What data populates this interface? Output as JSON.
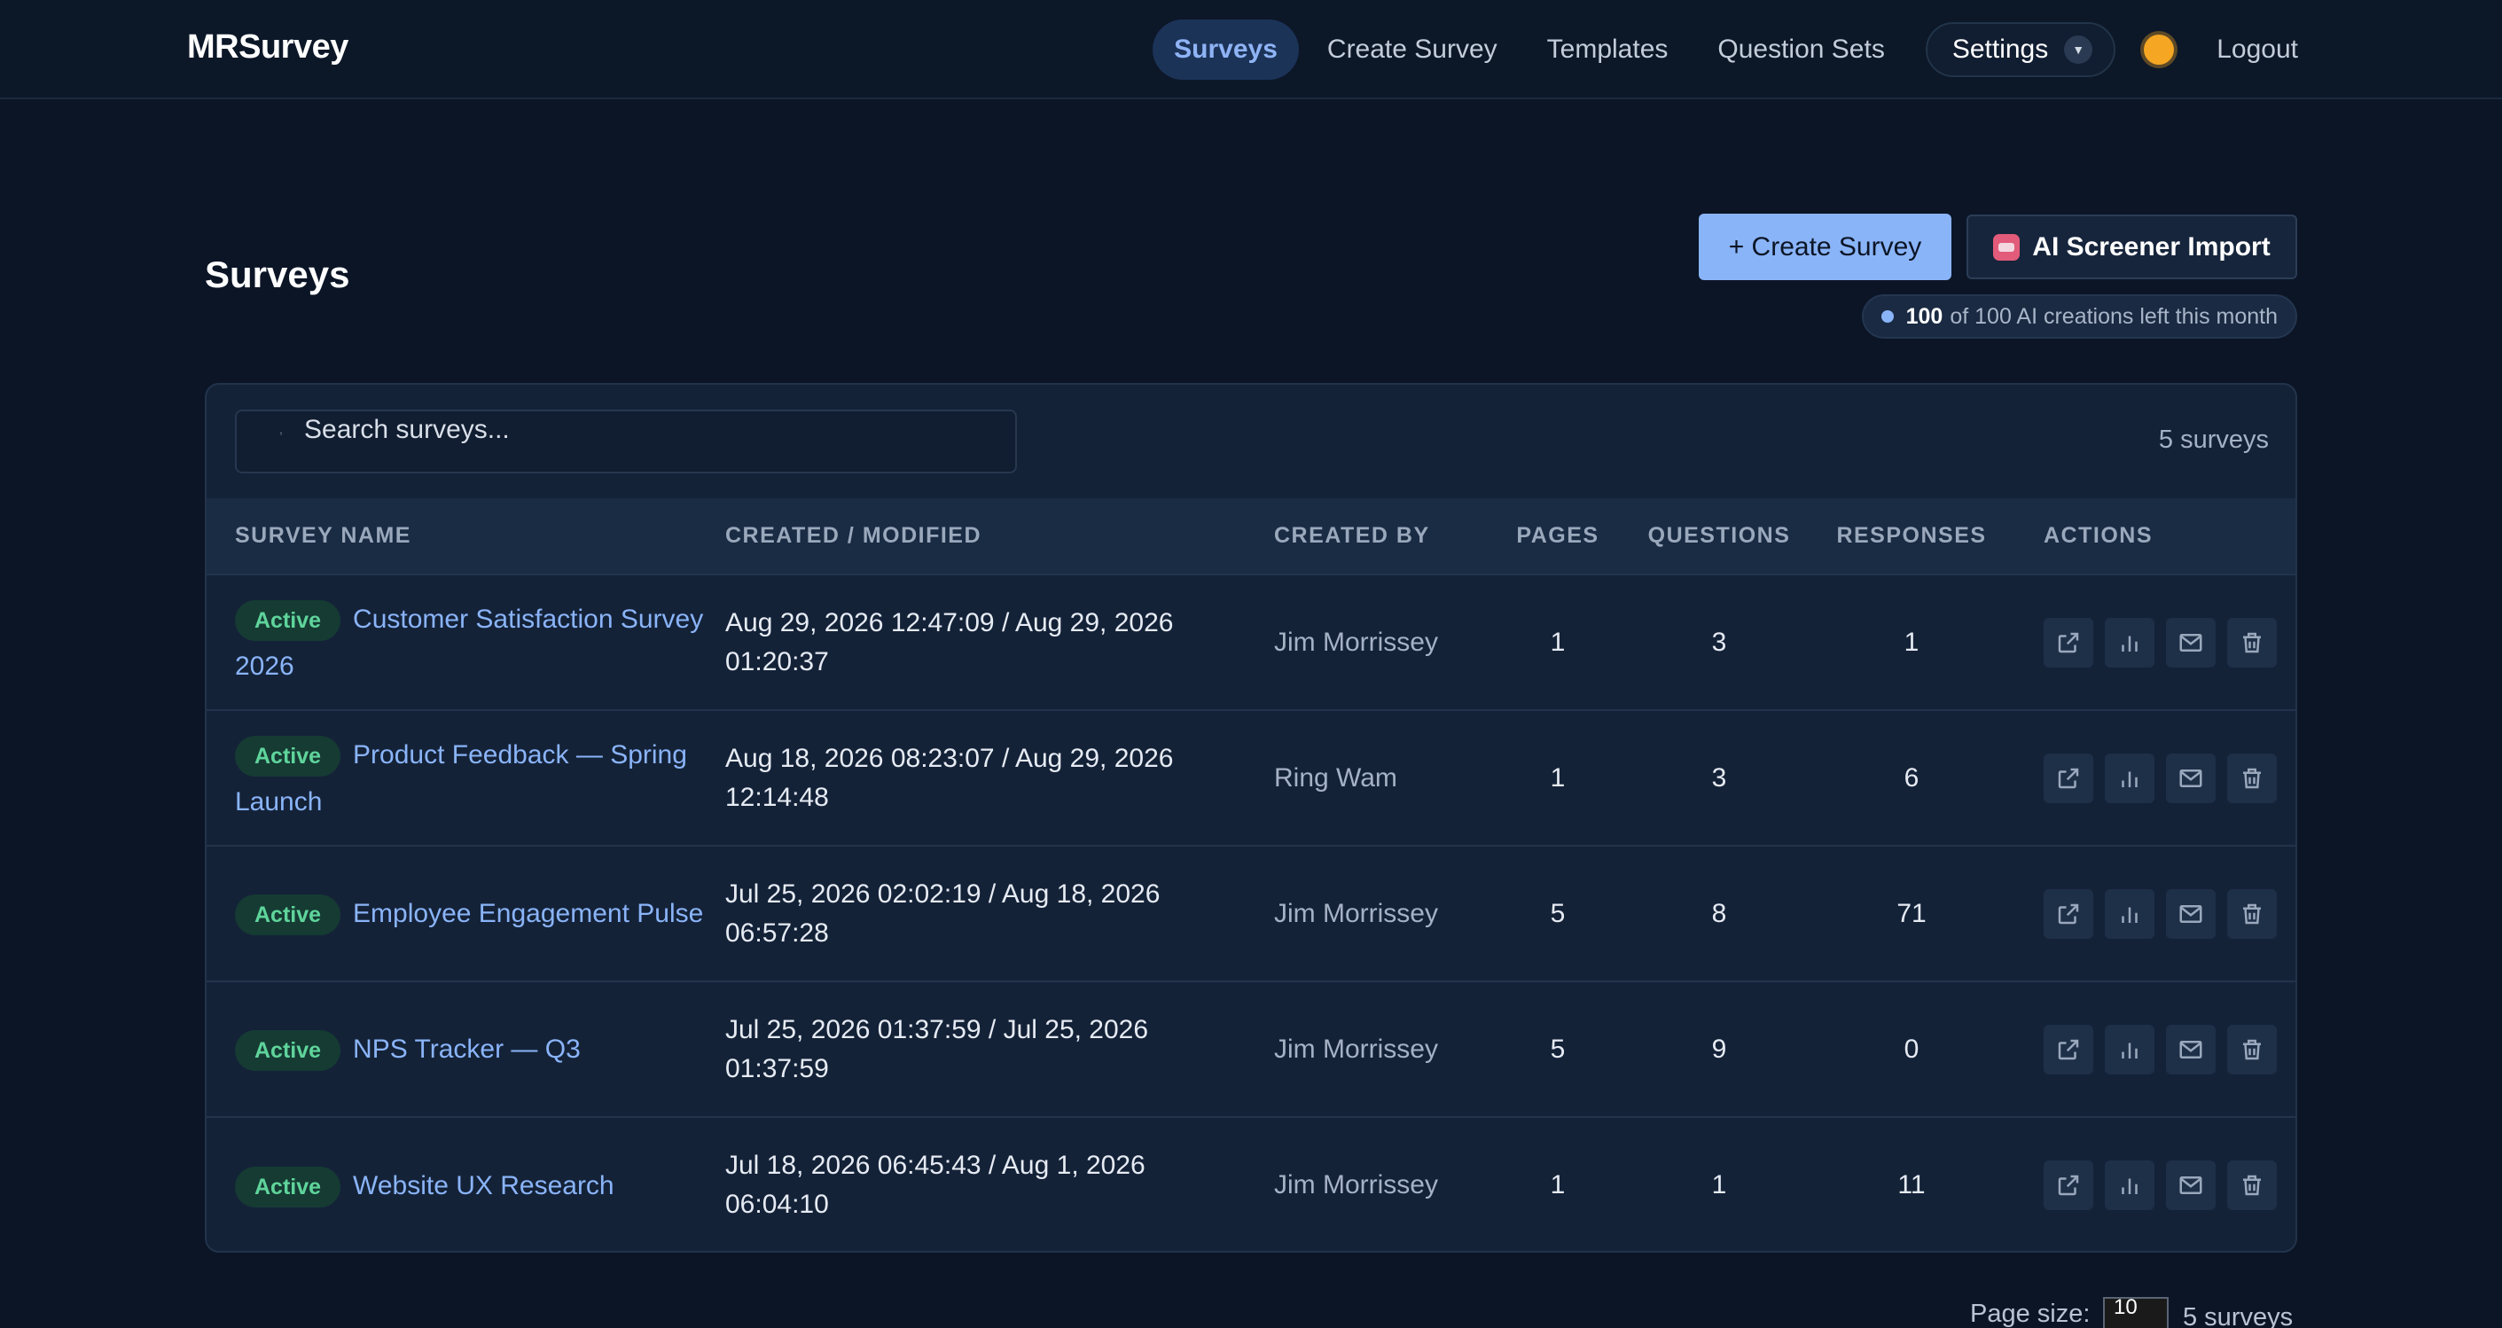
{
  "nav": {
    "brand": "MRSurvey",
    "links": [
      "Surveys",
      "Create Survey",
      "Templates",
      "Question Sets"
    ],
    "active": "Surveys",
    "settings_label": "Settings",
    "logout_label": "Logout",
    "theme_icon": "sun-icon"
  },
  "header": {
    "title": "Surveys",
    "create_label": "+ Create Survey",
    "ai_label": "AI Screener Import",
    "quota_count": "100",
    "quota_text": "of 100 AI creations left this month"
  },
  "search": {
    "placeholder": "Search surveys...",
    "count": "5 surveys"
  },
  "table": {
    "columns": [
      "SURVEY NAME",
      "CREATED / MODIFIED",
      "CREATED BY",
      "PAGES",
      "QUESTIONS",
      "RESPONSES",
      "ACTIONS"
    ],
    "rows": [
      {
        "status": "Active",
        "name": "Customer Satisfaction Survey 2026",
        "dates": "Aug 29, 2026 12:47:09 / Aug 29, 2026 01:20:37",
        "by": "Jim Morrissey",
        "pages": "1",
        "questions": "3",
        "responses": "1"
      },
      {
        "status": "Active",
        "name": "Product Feedback — Spring Launch",
        "dates": "Aug 18, 2026 08:23:07 / Aug 29, 2026 12:14:48",
        "by": "Ring Wam",
        "pages": "1",
        "questions": "3",
        "responses": "6"
      },
      {
        "status": "Active",
        "name": "Employee Engagement Pulse",
        "dates": "Jul 25, 2026 02:02:19 / Aug 18, 2026 06:57:28",
        "by": "Jim Morrissey",
        "pages": "5",
        "questions": "8",
        "responses": "71"
      },
      {
        "status": "Active",
        "name": "NPS Tracker — Q3",
        "dates": "Jul 25, 2026 01:37:59 / Jul 25, 2026 01:37:59",
        "by": "Jim Morrissey",
        "pages": "5",
        "questions": "9",
        "responses": "0"
      },
      {
        "status": "Active",
        "name": "Website UX Research",
        "dates": "Jul 18, 2026 06:45:43 / Aug 1, 2026 06:04:10",
        "by": "Jim Morrissey",
        "pages": "1",
        "questions": "1",
        "responses": "11"
      }
    ],
    "action_icons": [
      "external-link-icon",
      "bar-chart-icon",
      "mail-icon",
      "trash-icon"
    ]
  },
  "footer": {
    "page_size_label": "Page size:",
    "page_size_value": "10",
    "count": "5 surveys"
  },
  "colors": {
    "background": "#0b1526",
    "card": "#142238",
    "accent": "#8ab4f8",
    "active_badge": "#5fd49b"
  }
}
